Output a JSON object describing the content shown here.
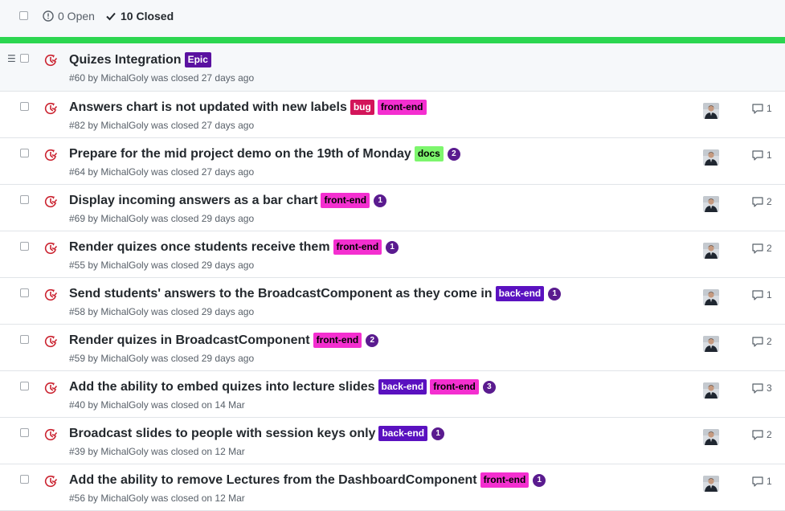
{
  "header": {
    "open_label": "0 Open",
    "closed_label": "10 Closed",
    "progress_fraction": 1.0,
    "progress_color": "#2cd650"
  },
  "icons": {
    "open": "issue-opened-icon",
    "closed": "check-icon",
    "issue_closed": "issue-closed-icon",
    "drag": "drag-handle-icon",
    "comment": "comment-icon"
  },
  "label_colors": {
    "Epic": {
      "bg": "#5a11a0",
      "fg": "#ffffff"
    },
    "bug": {
      "bg": "#d3155a",
      "fg": "#ffffff"
    },
    "front-end": {
      "bg": "#f42fd0",
      "fg": "#000000"
    },
    "back-end": {
      "bg": "#5a11c0",
      "fg": "#ffffff"
    },
    "docs": {
      "bg": "#7df66d",
      "fg": "#000000"
    }
  },
  "issues": [
    {
      "title": "Quizes Integration",
      "labels": [
        "Epic"
      ],
      "milestone": "",
      "meta": "#60 by MichalGoly was closed 27 days ago",
      "comments": ""
    },
    {
      "title": "Answers chart is not updated with new labels",
      "labels": [
        "bug",
        "front-end"
      ],
      "milestone": "",
      "meta": "#82 by MichalGoly was closed 27 days ago",
      "comments": "1"
    },
    {
      "title": "Prepare for the mid project demo on the 19th of Monday",
      "labels": [
        "docs"
      ],
      "milestone": "2",
      "meta": "#64 by MichalGoly was closed 27 days ago",
      "comments": "1"
    },
    {
      "title": "Display incoming answers as a bar chart",
      "labels": [
        "front-end"
      ],
      "milestone": "1",
      "meta": "#69 by MichalGoly was closed 29 days ago",
      "comments": "2"
    },
    {
      "title": "Render quizes once students receive them",
      "labels": [
        "front-end"
      ],
      "milestone": "1",
      "meta": "#55 by MichalGoly was closed 29 days ago",
      "comments": "2"
    },
    {
      "title": "Send students' answers to the BroadcastComponent as they come in",
      "labels": [
        "back-end"
      ],
      "milestone": "1",
      "meta": "#58 by MichalGoly was closed 29 days ago",
      "comments": "1"
    },
    {
      "title": "Render quizes in BroadcastComponent",
      "labels": [
        "front-end"
      ],
      "milestone": "2",
      "meta": "#59 by MichalGoly was closed 29 days ago",
      "comments": "2"
    },
    {
      "title": "Add the ability to embed quizes into lecture slides",
      "labels": [
        "back-end",
        "front-end"
      ],
      "milestone": "3",
      "meta": "#40 by MichalGoly was closed on 14 Mar",
      "comments": "3"
    },
    {
      "title": "Broadcast slides to people with session keys only",
      "labels": [
        "back-end"
      ],
      "milestone": "1",
      "meta": "#39 by MichalGoly was closed on 12 Mar",
      "comments": "2"
    },
    {
      "title": "Add the ability to remove Lectures from the DashboardComponent",
      "labels": [
        "front-end"
      ],
      "milestone": "1",
      "meta": "#56 by MichalGoly was closed on 12 Mar",
      "comments": "1"
    }
  ]
}
